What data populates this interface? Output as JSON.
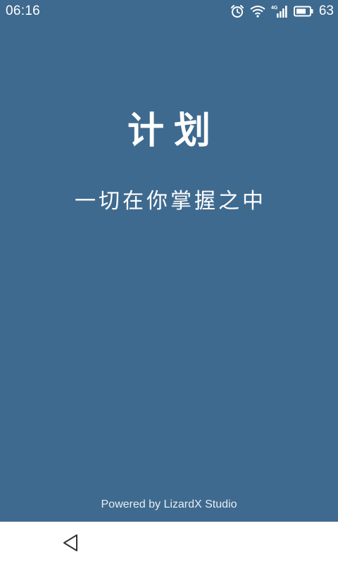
{
  "status_bar": {
    "time": "06:16",
    "network_label": "4G",
    "battery_level": "63",
    "icons": [
      "alarm-icon",
      "wifi-icon",
      "cellular-signal-icon",
      "battery-icon"
    ]
  },
  "splash": {
    "title": "计划",
    "slogan": "一切在你掌握之中",
    "footer": "Powered by LizardX Studio",
    "background_color": "#3f6a8f",
    "text_color": "#ffffff"
  },
  "nav_bar": {
    "icons": [
      "back-triangle-icon"
    ],
    "background_color": "#ffffff"
  }
}
